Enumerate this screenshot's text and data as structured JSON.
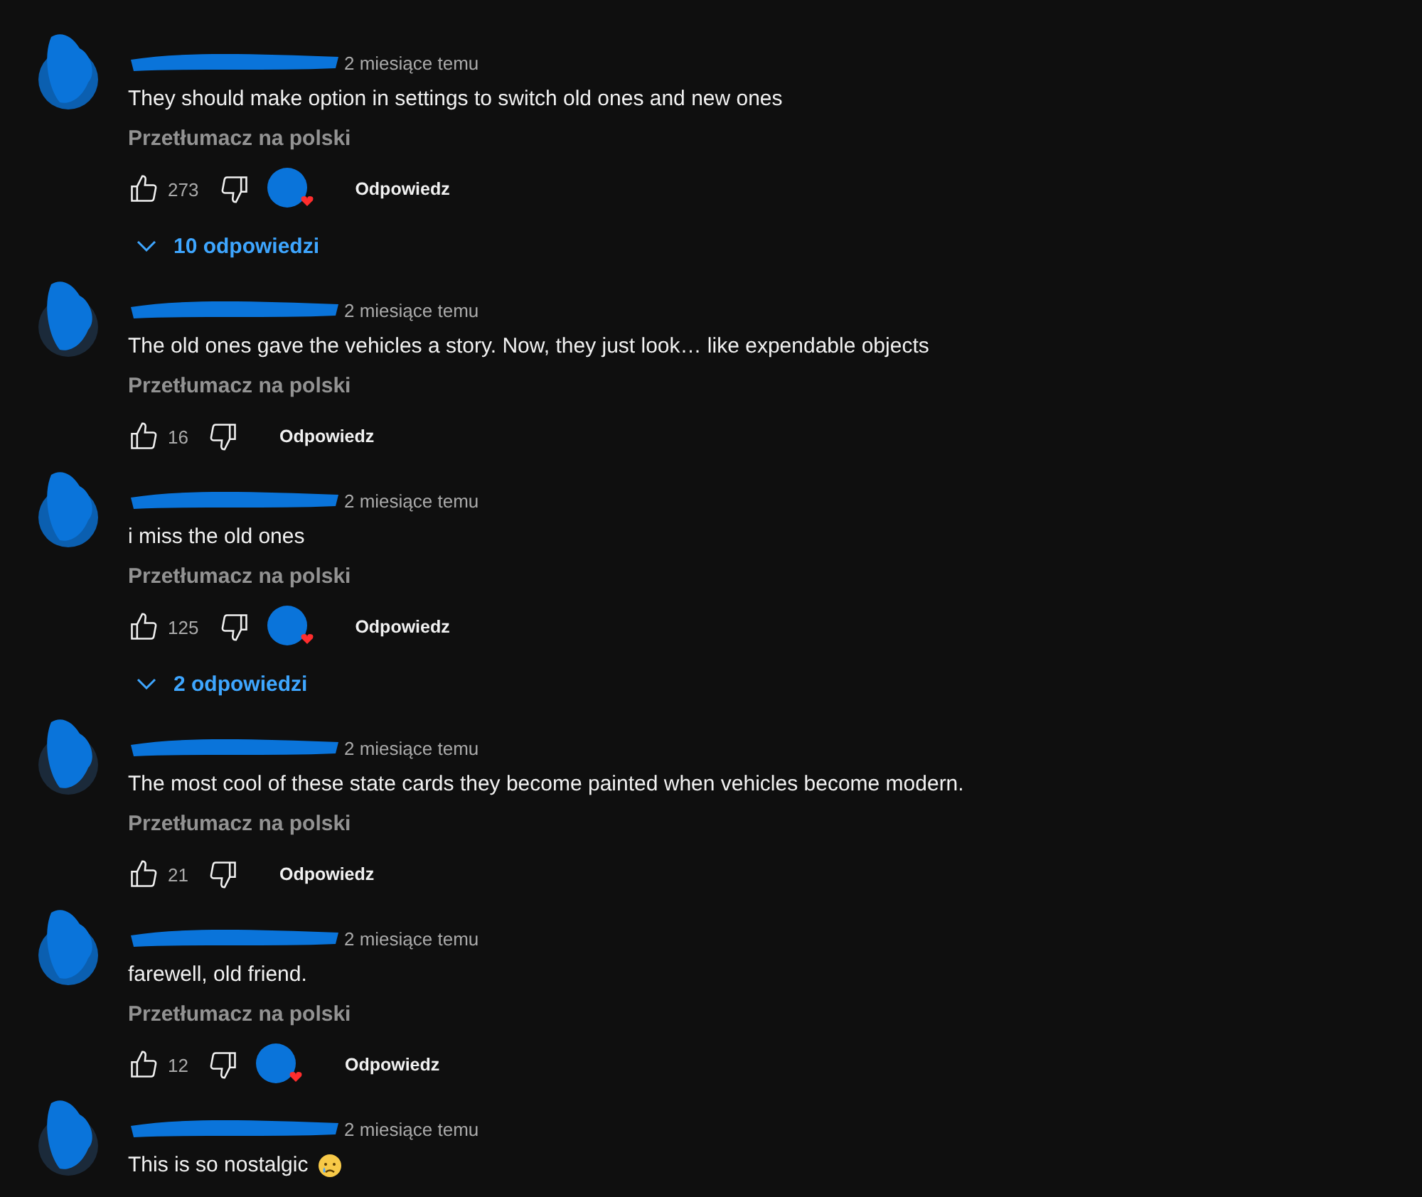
{
  "comments": [
    {
      "time": "2 miesiące temu",
      "text": "They should make option in settings to switch old ones and new ones",
      "translate": "Przetłumacz na polski",
      "likes": "273",
      "hearted": true,
      "reply": "Odpowiedz",
      "replies": "10 odpowiedzi"
    },
    {
      "time": "2 miesiące temu",
      "text": "The old ones gave the vehicles a story. Now, they just look… like expendable objects",
      "translate": "Przetłumacz na polski",
      "likes": "16",
      "hearted": false,
      "reply": "Odpowiedz"
    },
    {
      "time": "2 miesiące temu",
      "text": "i miss the old ones",
      "translate": "Przetłumacz na polski",
      "likes": "125",
      "hearted": true,
      "reply": "Odpowiedz",
      "replies": "2 odpowiedzi"
    },
    {
      "time": "2 miesiące temu",
      "text": "The most cool of these state cards they become painted when vehicles become modern.",
      "translate": "Przetłumacz na polski",
      "likes": "21",
      "hearted": false,
      "reply": "Odpowiedz"
    },
    {
      "time": "2 miesiące temu",
      "text": "farewell, old friend.",
      "translate": "Przetłumacz na polski",
      "likes": "12",
      "hearted": true,
      "reply": "Odpowiedz"
    },
    {
      "time": "2 miesiące temu",
      "text": "This is so nostalgic",
      "crying_emoji": true
    }
  ]
}
